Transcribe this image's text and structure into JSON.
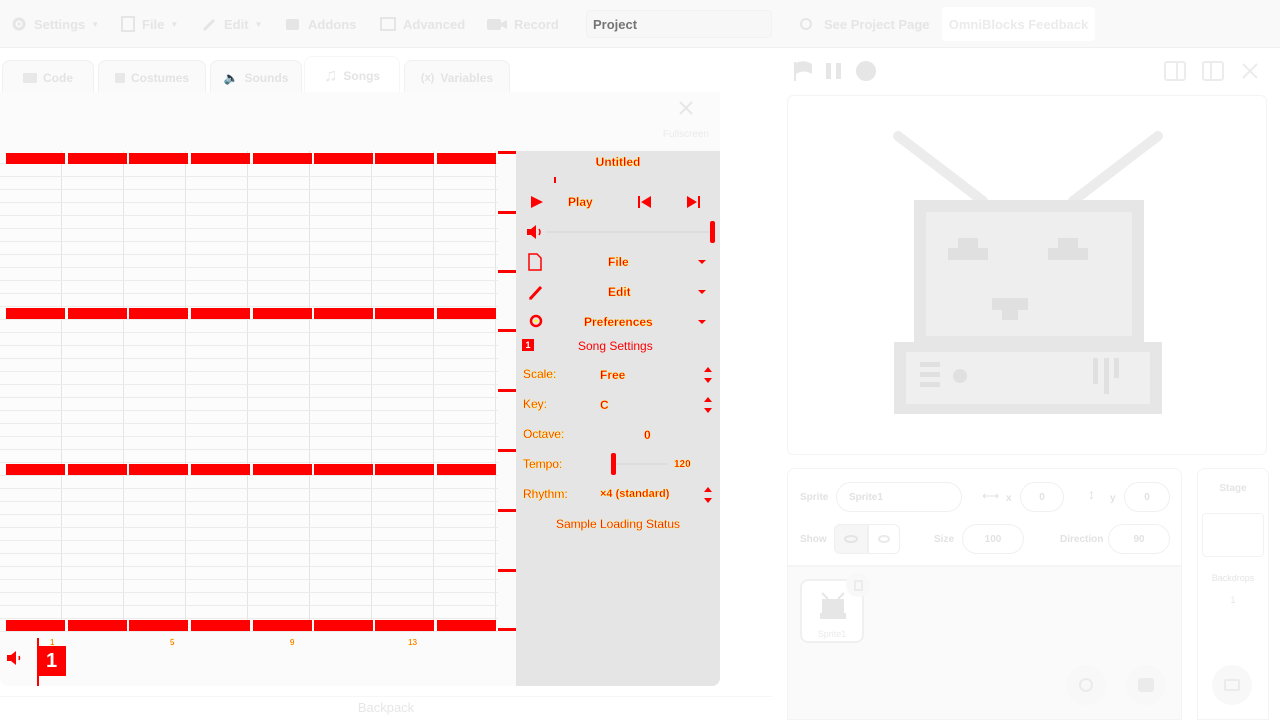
{
  "menubar": {
    "settings": "Settings",
    "file": "File",
    "edit": "Edit",
    "addons": "Addons",
    "advanced": "Advanced",
    "record": "Record",
    "project_placeholder": "Project",
    "see_project": "See Project Page",
    "feedback": "OmniBlocks Feedback"
  },
  "tabs": [
    {
      "label": "Code"
    },
    {
      "label": "Costumes"
    },
    {
      "label": "Sounds"
    },
    {
      "label": "Songs"
    },
    {
      "label": "Variables"
    }
  ],
  "editor": {
    "fullscreen": "Fullscreen",
    "song_title": "Untitled",
    "play": "Play",
    "file_menu": "File",
    "edit_menu": "Edit",
    "preferences_menu": "Preferences",
    "song_settings_badge": "1",
    "song_settings": "Song Settings",
    "scale_label": "Scale:",
    "scale_value": "Free",
    "key_label": "Key:",
    "key_value": "C",
    "octave_label": "Octave:",
    "octave_value": "0",
    "tempo_label": "Tempo:",
    "tempo_value": "120",
    "rhythm_label": "Rhythm:",
    "rhythm_value": "×4 (standard)",
    "sample_status": "Sample Loading Status",
    "timeline_labels": [
      "1",
      "5",
      "9",
      "13"
    ],
    "track_number": "1"
  },
  "backpack": "Backpack",
  "sprite_info": {
    "sprite_label": "Sprite",
    "sprite_name": "Sprite1",
    "x_label": "x",
    "x_value": "0",
    "y_label": "y",
    "y_value": "0",
    "show_label": "Show",
    "size_label": "Size",
    "size_value": "100",
    "direction_label": "Direction",
    "direction_value": "90",
    "sprite_thumb_name": "Sprite1"
  },
  "stage_pane": {
    "title": "Stage",
    "backdrops_label": "Backdrops",
    "backdrops_count": "1"
  },
  "colors": {
    "accent": "#ff0000",
    "highlight": "#ffff00",
    "panel": "#e5e5e5"
  }
}
